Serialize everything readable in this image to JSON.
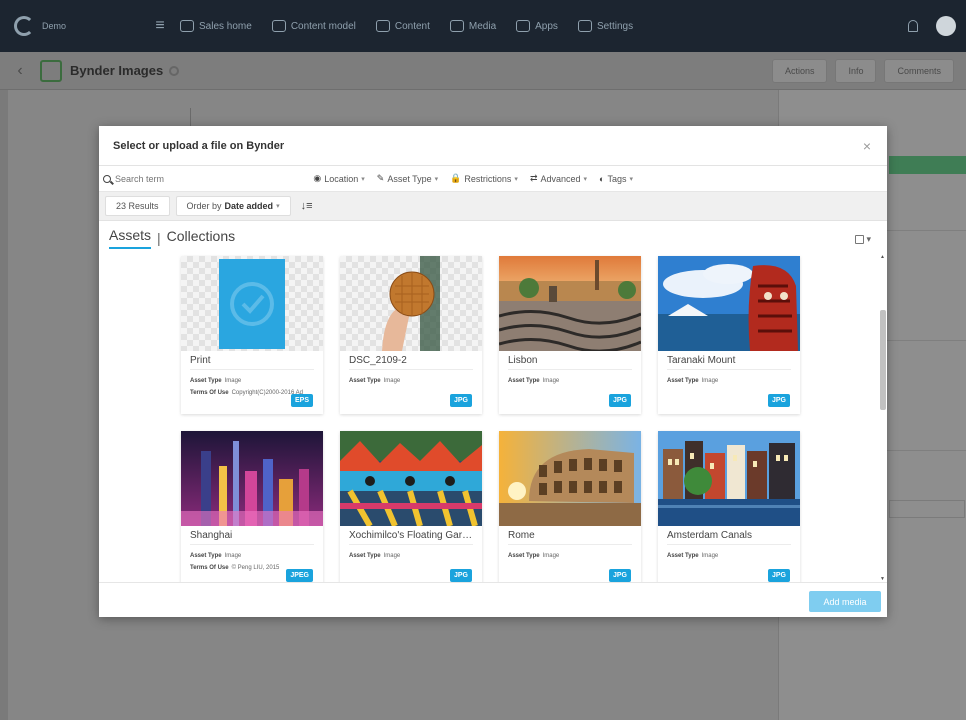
{
  "app": {
    "brand_name": "Demo",
    "nav": [
      "Sales home",
      "Content model",
      "Content",
      "Media",
      "Apps",
      "Settings"
    ],
    "page_title": "Bynder Images",
    "subbar_buttons": [
      "Actions",
      "Info",
      "Comments"
    ]
  },
  "modal": {
    "title": "Select or upload a file on Bynder",
    "close_label": "×",
    "search_placeholder": "Search term",
    "filters": [
      {
        "icon": "◉",
        "label": "Location"
      },
      {
        "icon": "✎",
        "label": "Asset Type"
      },
      {
        "icon": "🔒",
        "label": "Restrictions"
      },
      {
        "icon": "⇄",
        "label": "Advanced"
      },
      {
        "icon": "◐",
        "label": "Tags"
      }
    ],
    "results_count": "23 Results",
    "order_by_label": "Order by",
    "order_by_value": "Date added",
    "sort_icon": "↓≡",
    "tabs": {
      "assets": "Assets",
      "separator": "|",
      "collections": "Collections"
    },
    "add_button": "Add media"
  },
  "assets": [
    {
      "name": "Print",
      "meta1_label": "Asset Type",
      "meta1_value": "Image",
      "meta2_label": "Terms Of Use",
      "meta2_value": "Copyright(C)2000-2016 Ad",
      "format": "EPS"
    },
    {
      "name": "DSC_2109-2",
      "meta1_label": "Asset Type",
      "meta1_value": "Image",
      "format": "JPG"
    },
    {
      "name": "Lisbon",
      "meta1_label": "Asset Type",
      "meta1_value": "Image",
      "format": "JPG"
    },
    {
      "name": "Taranaki Mount",
      "meta1_label": "Asset Type",
      "meta1_value": "Image",
      "format": "JPG"
    },
    {
      "name": "Shanghai",
      "meta1_label": "Asset Type",
      "meta1_value": "Image",
      "meta2_label": "Terms Of Use",
      "meta2_value": "© Peng LIU, 2015",
      "format": "JPEG"
    },
    {
      "name": "Xochimilco's Floating Gard...",
      "meta1_label": "Asset Type",
      "meta1_value": "Image",
      "format": "JPG"
    },
    {
      "name": "Rome",
      "meta1_label": "Asset Type",
      "meta1_value": "Image",
      "format": "JPG"
    },
    {
      "name": "Amsterdam Canals",
      "meta1_label": "Asset Type",
      "meta1_value": "Image",
      "format": "JPG"
    }
  ],
  "colors": {
    "accent": "#1aa3dd",
    "topbar": "#1c2530",
    "overlay": "#8a8a8a"
  }
}
